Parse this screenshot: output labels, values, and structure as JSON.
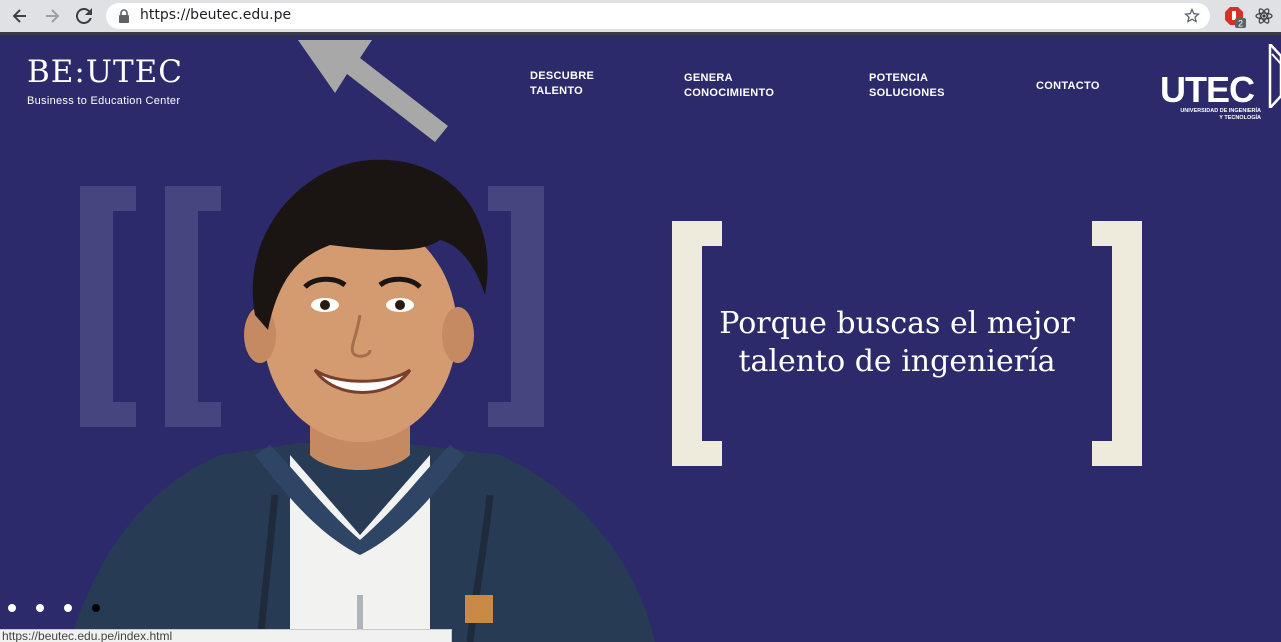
{
  "browser": {
    "url": "https://beutec.edu.pe",
    "status_url": "https://beutec.edu.pe/index.html",
    "extension_badge": "2"
  },
  "brand": {
    "logo_text": "BE:UTEC",
    "tagline": "Business to Education Center"
  },
  "nav": {
    "items": [
      {
        "line1": "DESCUBRE",
        "line2": "TALENTO"
      },
      {
        "line1": "GENERA",
        "line2": "CONOCIMIENTO"
      },
      {
        "line1": "POTENCIA",
        "line2": "SOLUCIONES"
      },
      {
        "line1": "CONTACTO",
        "line2": ""
      }
    ]
  },
  "partner": {
    "logo_text": "UTEC",
    "sub_line1": "UNIVERSIDAD DE INGENIERÍA",
    "sub_line2": "Y TECNOLOGÍA"
  },
  "hero": {
    "headline_line1": "Porque buscas el mejor",
    "headline_line2": "talento de ingeniería"
  },
  "slider": {
    "total": 4,
    "active_index": 3
  },
  "colors": {
    "background": "#2c2a6b",
    "bracket": "#eeeadc",
    "deco_bracket": "#45457f",
    "arrow": "#a8a8a8"
  }
}
